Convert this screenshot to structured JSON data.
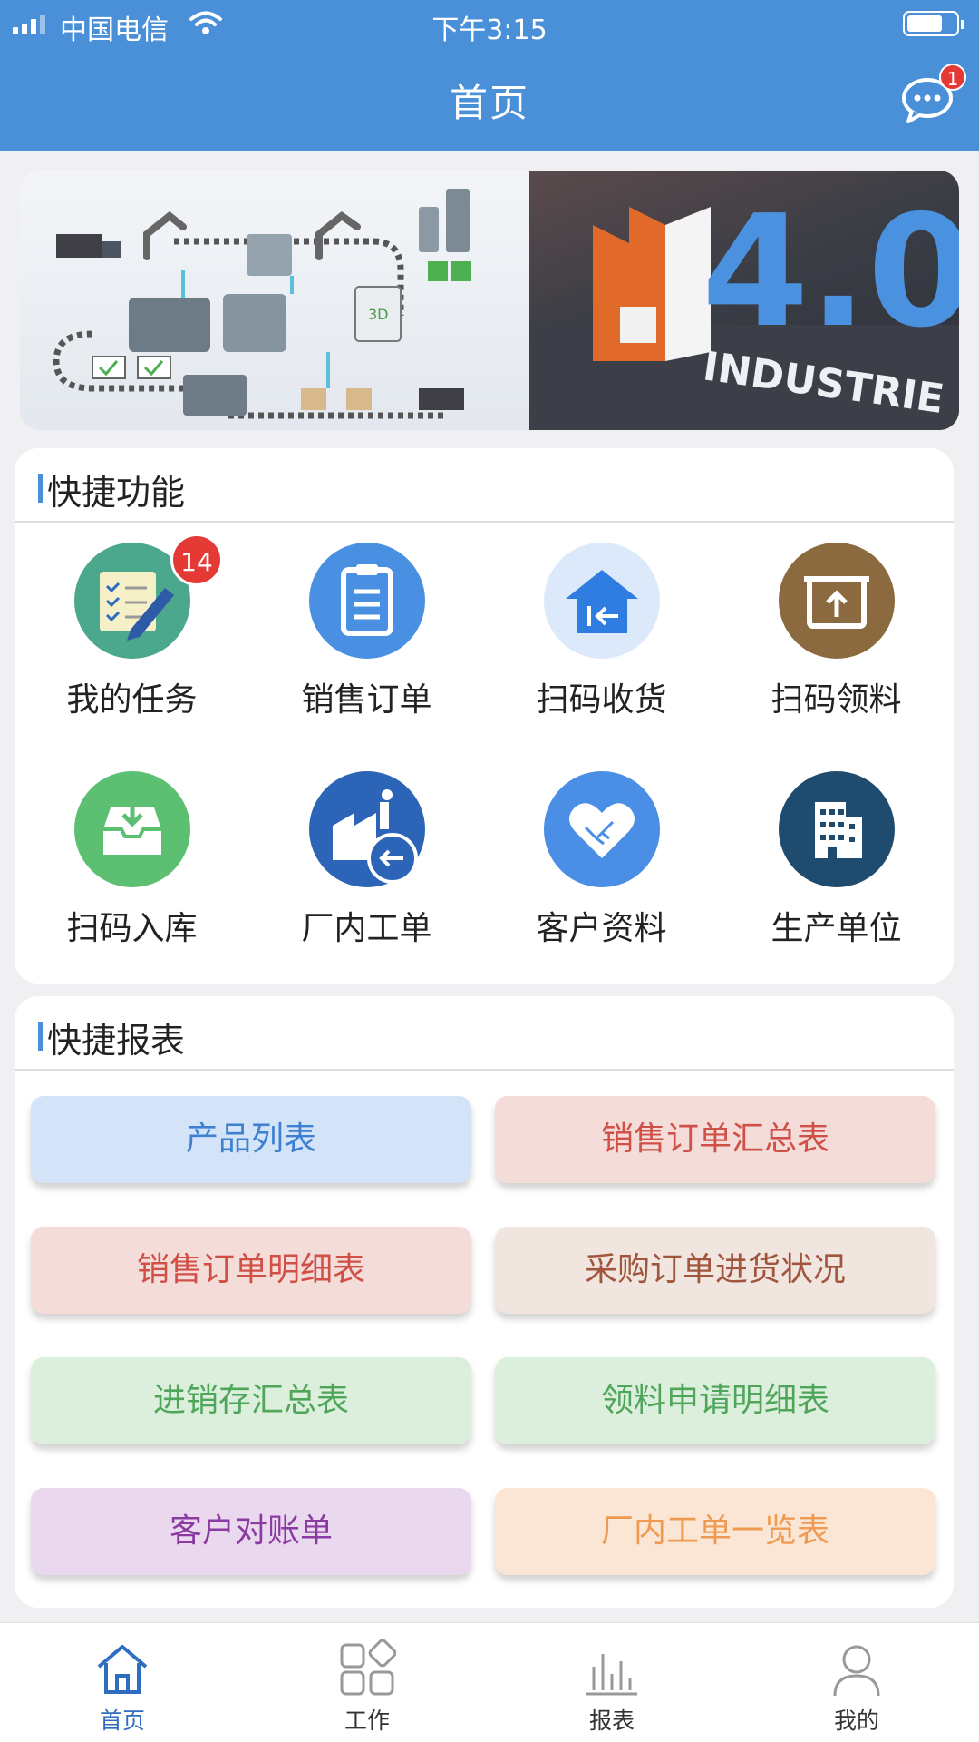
{
  "status_bar": {
    "carrier": "中国电信",
    "time": "下午3:15"
  },
  "header": {
    "title": "首页",
    "message_badge": "1"
  },
  "banner": {
    "text_big": "4.0",
    "text_small": "INDUSTRIE",
    "badge_3d": "3D"
  },
  "quick_functions": {
    "title": "快捷功能",
    "items": [
      {
        "label": "我的任务",
        "icon": "task-list-icon",
        "color": "#4ca88d",
        "badge": "14"
      },
      {
        "label": "销售订单",
        "icon": "clipboard-icon",
        "color": "#4a90e2"
      },
      {
        "label": "扫码收货",
        "icon": "receive-home-icon",
        "color": "#dbe9fb"
      },
      {
        "label": "扫码领料",
        "icon": "box-upload-icon",
        "color": "#8a6a3e"
      },
      {
        "label": "扫码入库",
        "icon": "inbox-download-icon",
        "color": "#5cbf72"
      },
      {
        "label": "厂内工单",
        "icon": "factory-return-icon",
        "color": "#2c64b8"
      },
      {
        "label": "客户资料",
        "icon": "handshake-heart-icon",
        "color": "#4b8ee6"
      },
      {
        "label": "生产单位",
        "icon": "building-icon",
        "color": "#1f4b6e"
      }
    ]
  },
  "quick_reports": {
    "title": "快捷报表",
    "items": [
      {
        "label": "产品列表",
        "bg": "#d3e4f9",
        "fg": "#3f7fd0"
      },
      {
        "label": "销售订单汇总表",
        "bg": "#f4dcd9",
        "fg": "#d05048"
      },
      {
        "label": "销售订单明细表",
        "bg": "#f4dcd9",
        "fg": "#d05048"
      },
      {
        "label": "采购订单进货状况",
        "bg": "#f1e5e0",
        "fg": "#a0553c"
      },
      {
        "label": "进销存汇总表",
        "bg": "#dcefdc",
        "fg": "#4fa55a"
      },
      {
        "label": "领料申请明细表",
        "bg": "#dcefdc",
        "fg": "#4fa55a"
      },
      {
        "label": "客户对账单",
        "bg": "#ead8ef",
        "fg": "#8a3aa0"
      },
      {
        "label": "厂内工单一览表",
        "bg": "#fbe6d5",
        "fg": "#ef9a50"
      }
    ]
  },
  "tabbar": {
    "items": [
      {
        "label": "首页",
        "icon": "home-icon",
        "active": true
      },
      {
        "label": "工作",
        "icon": "apps-icon",
        "active": false
      },
      {
        "label": "报表",
        "icon": "bar-chart-icon",
        "active": false
      },
      {
        "label": "我的",
        "icon": "person-icon",
        "active": false
      }
    ]
  }
}
